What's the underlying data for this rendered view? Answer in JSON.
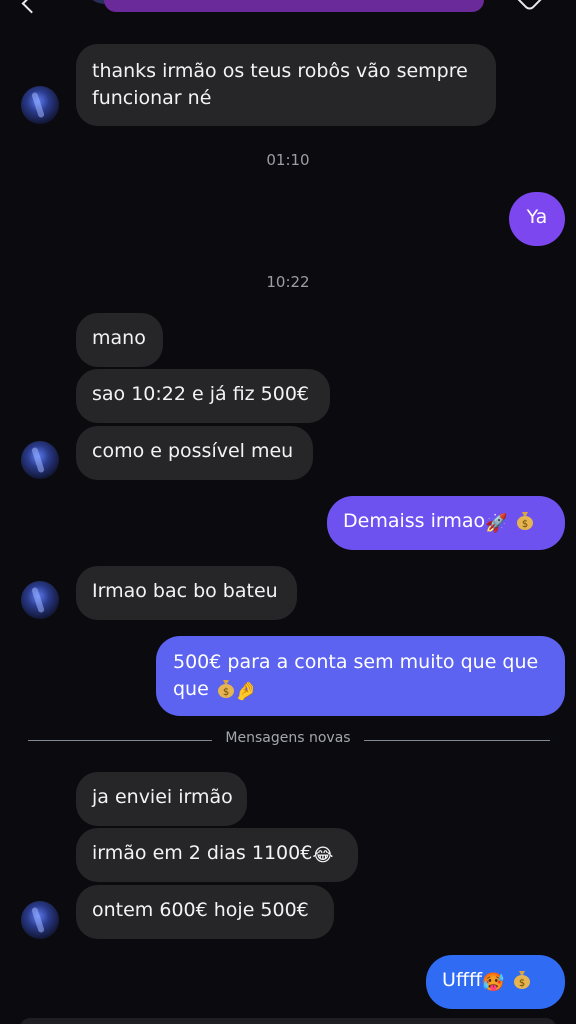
{
  "messages": {
    "m1_line1": "thanks irmão os teus robôs vão sempre",
    "m1_line2": "funcionar né",
    "ts1": "01:10",
    "m2": "Ya",
    "ts2": "10:22",
    "m3": "mano",
    "m4": "sao 10:22 e já fiz 500€",
    "m5": "como e possível meu",
    "m6": "Demaiss irmao",
    "m7": "Irmao bac bo bateu",
    "m8_line1": "500€ para a conta sem muito que que",
    "m8_line2": "que",
    "m9": "ja enviei irmão",
    "m10": "irmão em 2 dias 1100€",
    "m11": "ontem 600€ hoje 500€",
    "m12": "Uffff"
  },
  "divider_label": "Mensagens novas",
  "emojis": {
    "rocket": "🚀",
    "pinch": "🤌",
    "laugh": "😂",
    "hot": "🥵"
  },
  "icons": [
    "back-icon",
    "avatar",
    "chevron-down-icon",
    "call-icon",
    "video-icon",
    "tag-icon",
    "money-bag-icon"
  ],
  "colors": {
    "background": "#0b0b0f",
    "incoming_bubble": "#262629",
    "outgoing_purple": "#7d47f0",
    "outgoing_indigo": "#6a5cf2",
    "outgoing_blue": "#2f6cf3",
    "timestamp": "#9c9ca3"
  }
}
